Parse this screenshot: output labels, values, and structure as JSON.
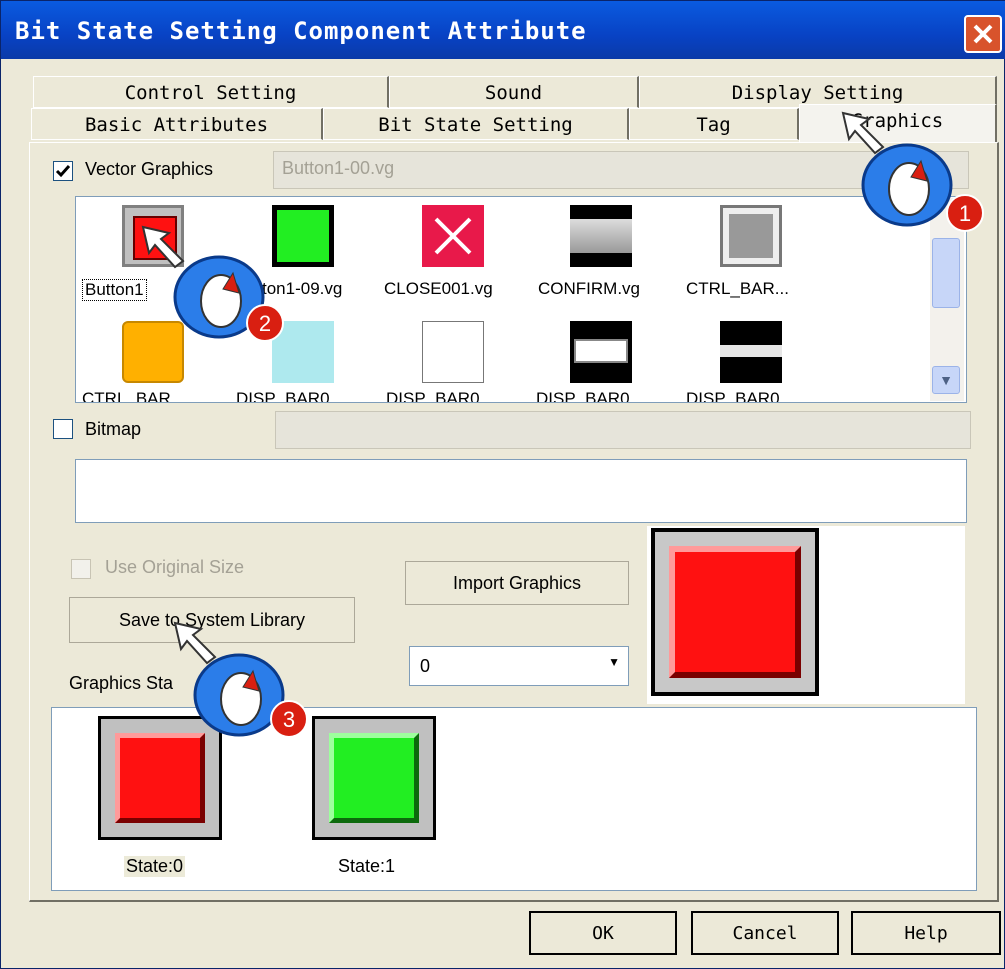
{
  "window": {
    "title": "Bit State Setting Component Attribute"
  },
  "tabs_row1": [
    {
      "label": "Control Setting"
    },
    {
      "label": "Sound"
    },
    {
      "label": "Display Setting"
    }
  ],
  "tabs_row2": [
    {
      "label": "Basic Attributes"
    },
    {
      "label": "Bit State Setting"
    },
    {
      "label": "Tag"
    },
    {
      "label": "Graphics",
      "active": true
    }
  ],
  "vector": {
    "label": "Vector Graphics",
    "checked": true,
    "filename": "Button1-00.vg"
  },
  "gallery": {
    "row1": [
      {
        "label": "Button1",
        "icon": "red-button-icon"
      },
      {
        "label": "ton1-09.vg",
        "icon": "green-button-icon"
      },
      {
        "label": "CLOSE001.vg",
        "icon": "close-x-icon"
      },
      {
        "label": "CONFIRM.vg",
        "icon": "gray-bar-icon"
      },
      {
        "label": "CTRL_BAR...",
        "icon": "gray-square-icon"
      }
    ],
    "row2": [
      {
        "label": "CTRL_BAR",
        "icon": "orange-button-icon"
      },
      {
        "label": "DISP_BAR0",
        "icon": "cyan-square-icon"
      },
      {
        "label": "DISP_BAR0",
        "icon": "white-square-icon"
      },
      {
        "label": "DISP_BAR0",
        "icon": "white-bar-icon"
      },
      {
        "label": "DISP_BAR0",
        "icon": "black-bar-icon"
      }
    ]
  },
  "bitmap": {
    "label": "Bitmap",
    "checked": false
  },
  "use_original_size": "Use Original Size",
  "import_button": "Import Graphics",
  "save_button": "Save to System Library",
  "graphics_state_label": "Graphics Sta",
  "state_select": {
    "value": "0"
  },
  "states": [
    {
      "label": "State:0",
      "color": "#ff1111"
    },
    {
      "label": "State:1",
      "color": "#22ee22"
    }
  ],
  "buttons": {
    "ok": "OK",
    "cancel": "Cancel",
    "help": "Help"
  },
  "markers": [
    "1",
    "2",
    "3"
  ],
  "colors": {
    "titlebar": "#0842c4",
    "marker": "#d91f11",
    "cursor_ring": "#2b7de9"
  }
}
